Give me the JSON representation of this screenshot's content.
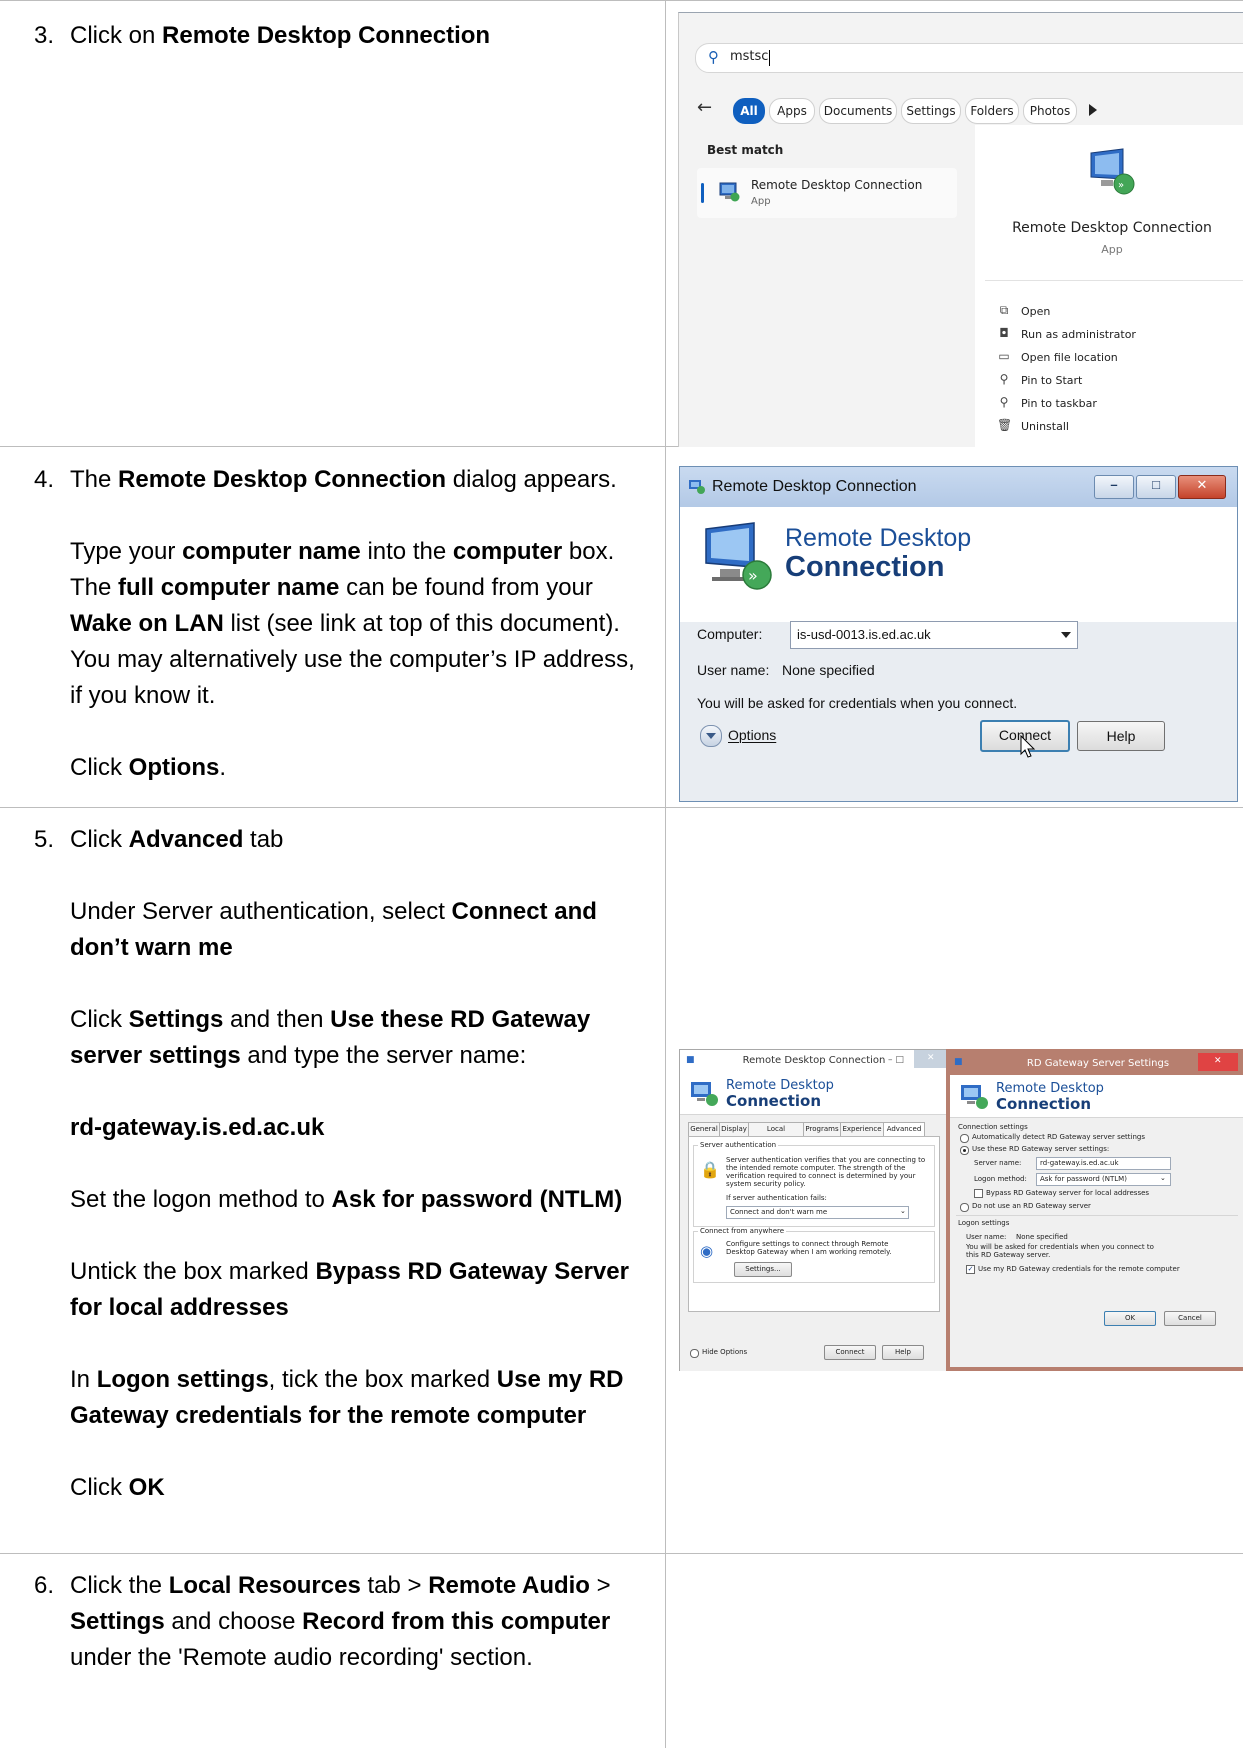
{
  "steps": [
    {
      "number": "3.",
      "paragraphs": [
        [
          {
            "t": "Click on "
          },
          {
            "t": "Remote Desktop Connection",
            "b": true
          }
        ]
      ]
    },
    {
      "number": "4.",
      "paragraphs": [
        [
          {
            "t": "The "
          },
          {
            "t": "Remote Desktop Connection",
            "b": true
          },
          {
            "t": " dialog appears."
          }
        ],
        [
          {
            "t": "Type your "
          },
          {
            "t": "computer name",
            "b": true
          },
          {
            "t": " into the "
          },
          {
            "t": "computer",
            "b": true
          },
          {
            "t": " box. The "
          },
          {
            "t": "full computer name",
            "b": true
          },
          {
            "t": " can be found from your "
          },
          {
            "t": "Wake on LAN",
            "b": true
          },
          {
            "t": " list (see link at top of this document). You may alternatively use the computer’s IP address, if you know it."
          }
        ],
        [
          {
            "t": "Click "
          },
          {
            "t": "Options",
            "b": true
          },
          {
            "t": "."
          }
        ]
      ]
    },
    {
      "number": "5.",
      "paragraphs": [
        [
          {
            "t": "Click "
          },
          {
            "t": "Advanced",
            "b": true
          },
          {
            "t": " tab"
          }
        ],
        [
          {
            "t": "Under Server authentication, select "
          },
          {
            "t": "Connect and don’t warn me",
            "b": true
          }
        ],
        [
          {
            "t": "Click "
          },
          {
            "t": "Settings",
            "b": true
          },
          {
            "t": " and then "
          },
          {
            "t": "Use these RD Gateway server settings",
            "b": true
          },
          {
            "t": " and type the server name:"
          }
        ],
        [
          {
            "t": "rd-gateway.is.ed.ac.uk",
            "b": true
          }
        ],
        [
          {
            "t": "Set the logon method to "
          },
          {
            "t": "Ask for password (NTLM)",
            "b": true
          }
        ],
        [
          {
            "t": "Untick the box marked "
          },
          {
            "t": "Bypass RD Gateway Server for local addresses",
            "b": true
          }
        ],
        [
          {
            "t": "In "
          },
          {
            "t": "Logon settings",
            "b": true
          },
          {
            "t": ", tick the box marked "
          },
          {
            "t": "Use my RD Gateway credentials for the remote computer",
            "b": true
          }
        ],
        [
          {
            "t": "Click "
          },
          {
            "t": "OK",
            "b": true
          }
        ]
      ]
    },
    {
      "number": "6.",
      "paragraphs": [
        [
          {
            "t": "Click the "
          },
          {
            "t": "Local Resources",
            "b": true
          },
          {
            "t": " tab > "
          },
          {
            "t": "Remote Audio",
            "b": true
          },
          {
            "t": " > "
          },
          {
            "t": "Settings",
            "b": true
          },
          {
            "t": " and choose "
          },
          {
            "t": "Record from this computer",
            "b": true
          },
          {
            "t": " under the 'Remote audio recording' section."
          }
        ]
      ]
    }
  ],
  "search_screenshot": {
    "query": "mstsc",
    "filters": [
      "All",
      "Apps",
      "Documents",
      "Settings",
      "Folders",
      "Photos"
    ],
    "best_match_label": "Best match",
    "result_name": "Remote Desktop Connection",
    "result_type": "App",
    "preview_name": "Remote Desktop Connection",
    "preview_type": "App",
    "actions": [
      {
        "icon": "open-icon",
        "glyph": "⧉",
        "label": "Open"
      },
      {
        "icon": "run-as-admin-icon",
        "glyph": "◘",
        "label": "Run as administrator"
      },
      {
        "icon": "folder-icon",
        "glyph": "▭",
        "label": "Open file location"
      },
      {
        "icon": "pin-icon",
        "glyph": "⚲",
        "label": "Pin to Start"
      },
      {
        "icon": "pin-icon",
        "glyph": "⚲",
        "label": "Pin to taskbar"
      },
      {
        "icon": "trash-icon",
        "glyph": "🗑",
        "label": "Uninstall"
      }
    ]
  },
  "rdc_dialog": {
    "title": "Remote Desktop Connection",
    "banner_line1": "Remote Desktop",
    "banner_line2": "Connection",
    "computer_label": "Computer:",
    "computer_value": "is-usd-0013.is.ed.ac.uk",
    "username_label": "User name:",
    "username_value": "None specified",
    "credentials_note": "You will be asked for credentials when you connect.",
    "options_label": "Options",
    "connect_label": "Connect",
    "help_label": "Help",
    "min_glyph": "–",
    "max_glyph": "□",
    "close_glyph": "✕"
  },
  "advanced_dialog": {
    "title": "Remote Desktop Connection",
    "title_controls": "–  □",
    "banner_line1": "Remote Desktop",
    "banner_line2": "Connection",
    "tabs": [
      "General",
      "Display",
      "Local Resources",
      "Programs",
      "Experience",
      "Advanced"
    ],
    "server_auth_group": "Server authentication",
    "server_auth_desc": "Server authentication verifies that you are connecting to the intended remote computer. The strength of the verification required to connect is determined by your system security policy.",
    "if_fails_label": "If server authentication fails:",
    "if_fails_value": "Connect and don't warn me",
    "connect_anywhere_group": "Connect from anywhere",
    "connect_anywhere_desc": "Configure settings to connect through Remote Desktop Gateway when I am working remotely.",
    "settings_button": "Settings...",
    "hide_options": "Hide Options",
    "connect_button": "Connect",
    "help_button": "Help"
  },
  "gateway_dialog": {
    "title": "RD Gateway Server Settings",
    "close_glyph": "✕",
    "banner_line1": "Remote Desktop",
    "banner_line2": "Connection",
    "connection_settings": "Connection settings",
    "auto_detect": "Automatically detect RD Gateway server settings",
    "use_these": "Use these RD Gateway server settings:",
    "server_name_label": "Server name:",
    "server_name_value": "rd-gateway.is.ed.ac.uk",
    "logon_method_label": "Logon method:",
    "logon_method_value": "Ask for password (NTLM)",
    "bypass_label": "Bypass RD Gateway server for local addresses",
    "do_not_use": "Do not use an RD Gateway server",
    "logon_settings": "Logon settings",
    "user_name_label": "User name:",
    "user_name_value": "None specified",
    "asked_note": "You will be asked for credentials when you connect to this RD Gateway server.",
    "use_my_creds": "Use my RD Gateway credentials for the remote computer",
    "ok_button": "OK",
    "cancel_button": "Cancel"
  }
}
